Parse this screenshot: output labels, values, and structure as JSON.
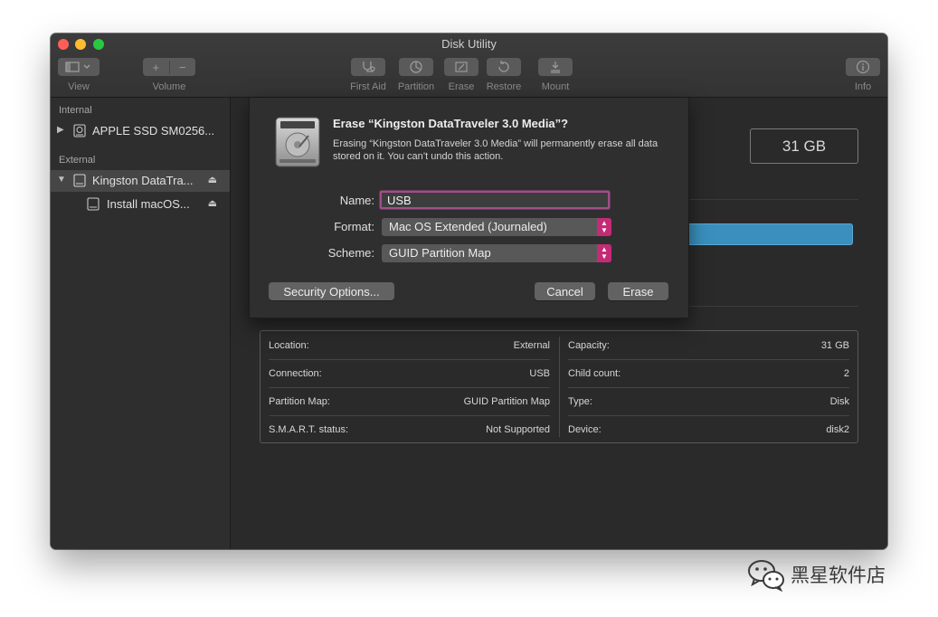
{
  "window": {
    "title": "Disk Utility"
  },
  "toolbar": {
    "view_label": "View",
    "volume_label": "Volume",
    "volume_add": "+",
    "volume_remove": "−",
    "first_aid_label": "First Aid",
    "partition_label": "Partition",
    "erase_label": "Erase",
    "restore_label": "Restore",
    "mount_label": "Mount",
    "info_label": "Info",
    "icons": [
      "sidebar-view-icon",
      "stethoscope-icon",
      "pie-chart-icon",
      "eraser-icon",
      "restore-icon",
      "mount-icon",
      "info-icon"
    ]
  },
  "sidebar": {
    "internal_heading": "Internal",
    "external_heading": "External",
    "items": [
      {
        "label": "APPLE SSD SM0256...",
        "expanded": false
      },
      {
        "label": "Kingston DataTra...",
        "expanded": true,
        "selected": true
      },
      {
        "label": "Install macOS..."
      }
    ],
    "eject_glyph": "⏏"
  },
  "main": {
    "capacity": "31 GB",
    "info": {
      "left": [
        {
          "label": "Location:",
          "value": "External"
        },
        {
          "label": "Connection:",
          "value": "USB"
        },
        {
          "label": "Partition Map:",
          "value": "GUID Partition Map"
        },
        {
          "label": "S.M.A.R.T. status:",
          "value": "Not Supported"
        }
      ],
      "right": [
        {
          "label": "Capacity:",
          "value": "31 GB"
        },
        {
          "label": "Child count:",
          "value": "2"
        },
        {
          "label": "Type:",
          "value": "Disk"
        },
        {
          "label": "Device:",
          "value": "disk2"
        }
      ]
    }
  },
  "sheet": {
    "title": "Erase “Kingston DataTraveler 3.0 Media”?",
    "message": "Erasing “Kingston DataTraveler 3.0 Media” will permanently erase all data stored on it. You can’t undo this action.",
    "name_label": "Name:",
    "name_value": "USB",
    "format_label": "Format:",
    "format_value": "Mac OS Extended (Journaled)",
    "scheme_label": "Scheme:",
    "scheme_value": "GUID Partition Map",
    "security_button": "Security Options...",
    "cancel_button": "Cancel",
    "erase_button": "Erase"
  },
  "watermark": {
    "text": "黑星软件店"
  },
  "colors": {
    "accent": "#c52a76",
    "focus_ring": "#a34d8a",
    "usage_bar": "#3a8fbd"
  }
}
